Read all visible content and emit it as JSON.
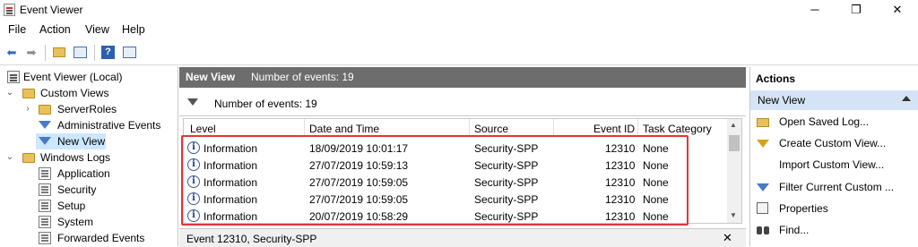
{
  "window": {
    "title": "Event Viewer",
    "minimize": "─",
    "maximize": "❐",
    "close": "✕"
  },
  "menu": [
    "File",
    "Action",
    "View",
    "Help"
  ],
  "tree": {
    "root": "Event Viewer (Local)",
    "custom_views": "Custom Views",
    "server_roles": "ServerRoles",
    "admin_events": "Administrative Events",
    "new_view": "New View",
    "windows_logs": "Windows Logs",
    "logs": [
      "Application",
      "Security",
      "Setup",
      "System",
      "Forwarded Events"
    ]
  },
  "center": {
    "title": "New View",
    "count_label": "Number of events: 19",
    "filter_label": "Number of events: 19",
    "columns": [
      "Level",
      "Date and Time",
      "Source",
      "Event ID",
      "Task Category"
    ],
    "rows": [
      {
        "level": "Information",
        "datetime": "18/09/2019 10:01:17",
        "source": "Security-SPP",
        "event_id": "12310",
        "task": "None"
      },
      {
        "level": "Information",
        "datetime": "27/07/2019 10:59:13",
        "source": "Security-SPP",
        "event_id": "12310",
        "task": "None"
      },
      {
        "level": "Information",
        "datetime": "27/07/2019 10:59:05",
        "source": "Security-SPP",
        "event_id": "12310",
        "task": "None"
      },
      {
        "level": "Information",
        "datetime": "27/07/2019 10:59:05",
        "source": "Security-SPP",
        "event_id": "12310",
        "task": "None"
      },
      {
        "level": "Information",
        "datetime": "20/07/2019 10:58:29",
        "source": "Security-SPP",
        "event_id": "12310",
        "task": "None"
      }
    ],
    "detail_title": "Event 12310, Security-SPP"
  },
  "actions": {
    "title": "Actions",
    "section": "New View",
    "items": [
      "Open Saved Log...",
      "Create Custom View...",
      "Import Custom View...",
      "Filter Current Custom ...",
      "Properties",
      "Find..."
    ]
  },
  "colors": {
    "highlight": "#e0363c",
    "header_bg": "#6d6d6d",
    "selection": "#cce8ff",
    "actions_section": "#d4e3f5"
  }
}
